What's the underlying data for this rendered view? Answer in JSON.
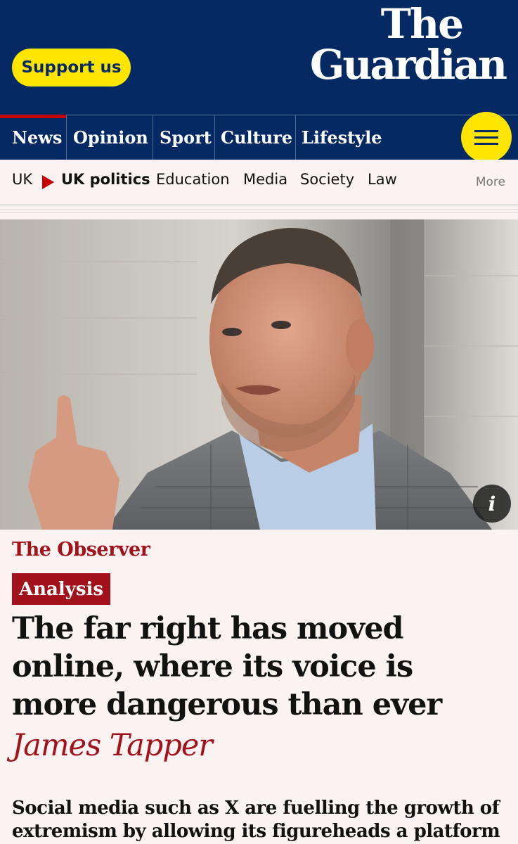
{
  "header": {
    "support_label": "Support us",
    "logo_line1": "The",
    "logo_line2": "Guardian",
    "brand_color": "#052962",
    "accent_color": "#ffe500"
  },
  "pillars": [
    {
      "label": "News",
      "active": true
    },
    {
      "label": "Opinion"
    },
    {
      "label": "Sport"
    },
    {
      "label": "Culture"
    },
    {
      "label": "Lifestyle"
    }
  ],
  "menu_icon": "hamburger-menu-icon",
  "subnav": {
    "items": [
      "UK",
      "UK politics",
      "Education",
      "Media",
      "Society",
      "Law"
    ],
    "current": "UK politics",
    "more_label": "More"
  },
  "image": {
    "info_label": "i"
  },
  "article": {
    "series": "The Observer",
    "label": "Analysis",
    "headline": "The far right has moved online, where its voice is more dangerous than ever",
    "byline": "James Tapper",
    "standfirst": "Social media such as X are fuelling the growth of extremism by allowing its figureheads a platform to",
    "accent_color": "#a1121b"
  }
}
